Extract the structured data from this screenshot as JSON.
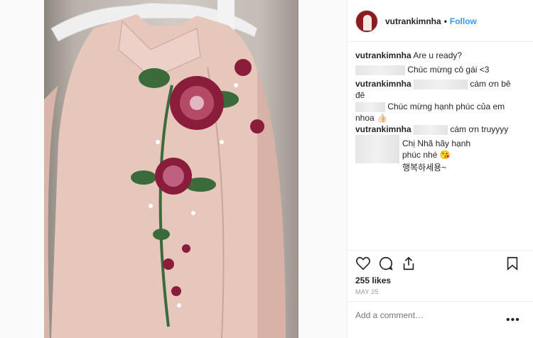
{
  "post": {
    "username": "vutrankimnha",
    "dot": "•",
    "follow_label": "Follow"
  },
  "comments": [
    {
      "user": "vutrankimnha",
      "text": "Are u ready?"
    },
    {
      "user": "",
      "text": "Chúc mừng cô gái <3"
    },
    {
      "user": "vutrankimnha",
      "text": "cám ơn bê",
      "text2": "đê"
    },
    {
      "user": "",
      "text": "Chúc mừng hạnh phúc của em",
      "text2": "nhoa 👍🏻"
    },
    {
      "user": "vutrankimnha",
      "text": "cám ơn truyyyy"
    },
    {
      "user": "",
      "text": "Chị Nhã hãy hạnh phúc nhé 😘",
      "text2": "행복하세용~"
    }
  ],
  "actions": {
    "icons": [
      "heart-icon",
      "comment-icon",
      "share-icon",
      "bookmark-icon"
    ]
  },
  "likes_label": "255 likes",
  "date_label": "MAY 25",
  "comment_input": {
    "placeholder": "Add a comment…"
  },
  "more_label": "•••",
  "colors": {
    "link": "#3897f0",
    "dress": "#e7c6bb",
    "flower": "#8a1d3c",
    "leaf": "#3b6b3b"
  }
}
